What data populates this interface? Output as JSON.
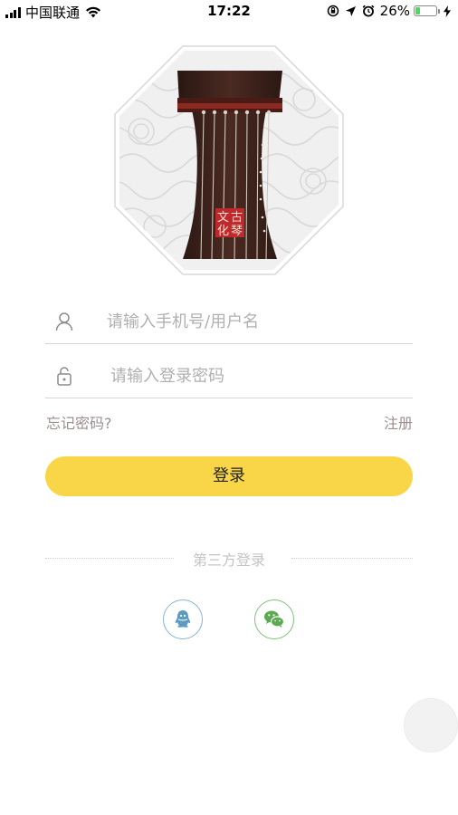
{
  "status_bar": {
    "carrier": "中国联通",
    "time": "17:22",
    "battery_percent": "26%",
    "battery_level": 0.26,
    "icons": [
      "signal-icon",
      "wifi-icon",
      "orientation-lock-icon",
      "location-icon",
      "alarm-icon",
      "battery-icon",
      "charging-icon"
    ]
  },
  "logo": {
    "seal_text": [
      "古",
      "琴",
      "文",
      "化"
    ],
    "icon": "guqin-logo"
  },
  "form": {
    "username_placeholder": "请输入手机号/用户名",
    "password_placeholder": "请输入登录密码",
    "username_icon": "user-icon",
    "password_icon": "unlock-icon"
  },
  "links": {
    "forgot": "忘记密码?",
    "register": "注册"
  },
  "login_button": "登录",
  "third_party": {
    "label": "第三方登录",
    "providers": [
      {
        "icon": "qq-icon",
        "color": "#86b5cf"
      },
      {
        "icon": "wechat-icon",
        "color": "#7dc27a"
      }
    ]
  },
  "colors": {
    "accent": "#f8d647",
    "link": "#9c8e8e",
    "seal_red": "#c0292b"
  }
}
